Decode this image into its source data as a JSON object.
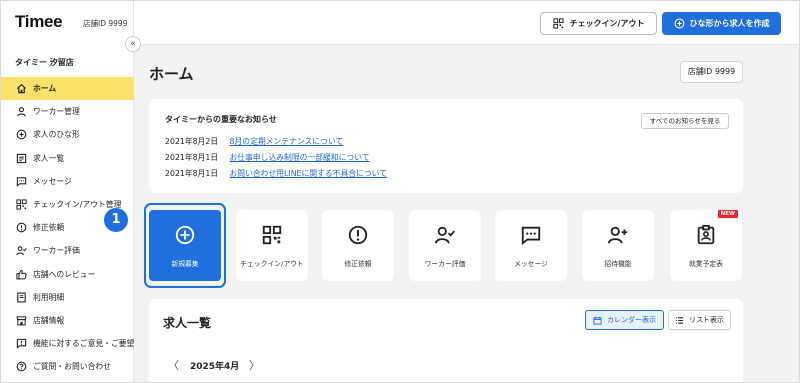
{
  "app": {
    "logo": "Timee",
    "store_id_short": "店舗ID 9999",
    "store_name": "タイミー 汐留店",
    "collapse": "«"
  },
  "sidebar": {
    "items": [
      {
        "label": "ホーム",
        "icon": "home-icon",
        "active": true
      },
      {
        "label": "ワーカー管理",
        "icon": "person-icon"
      },
      {
        "label": "求人のひな形",
        "icon": "plus-circle-icon"
      },
      {
        "label": "求人一覧",
        "icon": "list-icon"
      },
      {
        "label": "メッセージ",
        "icon": "message-icon"
      },
      {
        "label": "チェックイン/アウト管理",
        "icon": "qr-icon"
      },
      {
        "label": "修正依頼",
        "icon": "alert-icon"
      },
      {
        "label": "ワーカー評価",
        "icon": "person-check-icon"
      },
      {
        "label": "店舗へのレビュー",
        "icon": "thumb-icon"
      },
      {
        "label": "利用明細",
        "icon": "receipt-icon"
      },
      {
        "label": "店舗情報",
        "icon": "store-icon"
      },
      {
        "label": "機能に対するご意見・ご要望",
        "icon": "feedback-icon"
      },
      {
        "label": "ご質問・お問い合わせ",
        "icon": "question-icon"
      }
    ]
  },
  "topbar": {
    "checkin_label": "チェックイン/アウト",
    "create_label": "ひな形から求人を作成"
  },
  "main": {
    "title": "ホーム",
    "store_id": "店舗ID 9999",
    "notice": {
      "title": "タイミーからの重要なお知らせ",
      "all_label": "すべてのお知らせを見る",
      "items": [
        {
          "date": "2021年8月2日",
          "text": "8月の定期メンテナンスについて"
        },
        {
          "date": "2021年8月1日",
          "text": "お仕事申し込み制限の一部緩和について"
        },
        {
          "date": "2021年8月1日",
          "text": "お問い合わせ用LINEに関する不具合について"
        }
      ]
    },
    "step_number": "1",
    "tiles": [
      {
        "label": "新規募集",
        "icon": "plus-circle-icon"
      },
      {
        "label": "チェックイン/アウト",
        "icon": "qr-icon"
      },
      {
        "label": "修正依頼",
        "icon": "alert-icon"
      },
      {
        "label": "ワーカー評価",
        "icon": "person-check-icon"
      },
      {
        "label": "メッセージ",
        "icon": "message-icon"
      },
      {
        "label": "招待機能",
        "icon": "person-add-icon"
      },
      {
        "label": "就業予定表",
        "icon": "badge-icon",
        "badge": "NEW"
      }
    ],
    "joblist": {
      "title": "求人一覧",
      "calendar_label": "カレンダー表示",
      "list_label": "リスト表示",
      "month": "2025年4月",
      "prev": "〈",
      "next": "〉"
    }
  },
  "colors": {
    "accent": "#1f6fdc",
    "active_nav": "#fbe26a",
    "new_badge": "#e8262b",
    "link": "#1f66d2"
  }
}
